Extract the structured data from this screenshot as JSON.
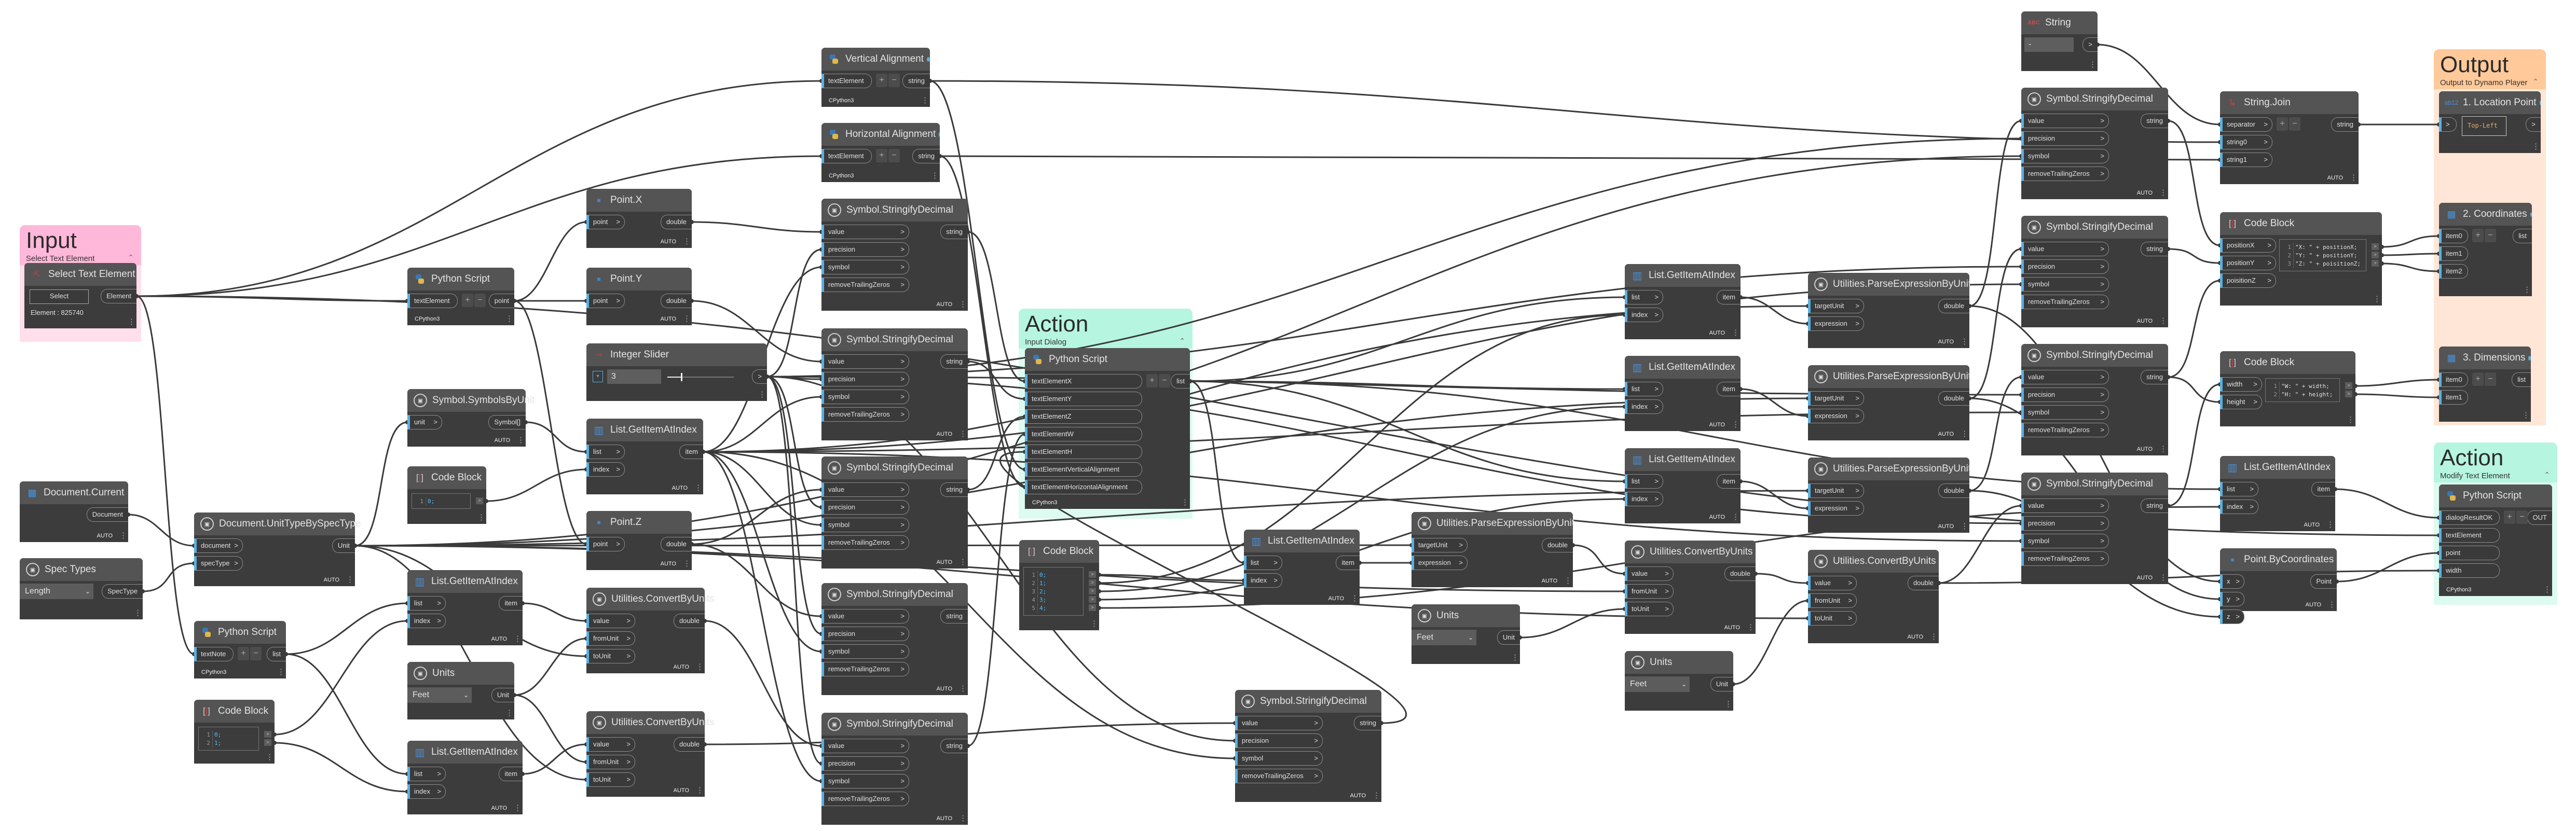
{
  "canvas": {
    "background": "#ffffff",
    "wire_color": "#3a3a3a",
    "port_accent": "#5bb0e0"
  },
  "groups": [
    {
      "title": "Input",
      "subtitle": "Select Text Element",
      "header_color": "#ffb8d9",
      "body_color": "#ffdfeb"
    },
    {
      "title": "Action",
      "subtitle": "Input Dialog",
      "header_color": "#b6f5df",
      "body_color": "#ddfbf0"
    },
    {
      "title": "Output",
      "subtitle": "Output to Dynamo Player",
      "header_color": "#ffc999",
      "body_color": "#ffe6d6"
    },
    {
      "title": "Action",
      "subtitle": "Modify Text Element",
      "header_color": "#b6f5df",
      "body_color": "#ddfbf0"
    }
  ],
  "nodes": [
    {
      "title": "Select Text Element",
      "icon": "select-element-icon",
      "pinned": true,
      "inputs": [],
      "outputs": [
        "Element"
      ],
      "footer": "",
      "widget": {
        "kind": "select",
        "button": "Select",
        "info": "Element : 825740"
      }
    },
    {
      "title": "Document.Current",
      "icon": "document-icon",
      "inputs": [],
      "outputs": [
        "Document"
      ],
      "footer": "AUTO"
    },
    {
      "title": "Spec Types",
      "icon": "revit-node-icon",
      "inputs": [],
      "outputs": [
        "SpecType"
      ],
      "footer": "",
      "widget": {
        "kind": "dropdown",
        "value": "Length"
      }
    },
    {
      "title": "Document.UnitTypeBySpecType",
      "icon": "revit-node-icon",
      "inputs": [
        "document",
        "specType"
      ],
      "outputs": [
        "Unit"
      ],
      "footer": "AUTO"
    },
    {
      "title": "Python Script",
      "icon": "python-icon",
      "plus_minus": true,
      "inputs": [
        "textNote"
      ],
      "outputs": [
        "list"
      ],
      "footer": "CPython3"
    },
    {
      "title": "Code Block",
      "icon": "code-block-icon",
      "inputs": [],
      "outputs": [],
      "footer": "",
      "widget": {
        "kind": "code",
        "lines": [
          {
            "n": "1",
            "code": "0;"
          },
          {
            "n": "2",
            "code": "1;"
          }
        ]
      }
    },
    {
      "title": "Python Script",
      "icon": "python-icon",
      "plus_minus": true,
      "inputs": [
        "textElement"
      ],
      "outputs": [
        "point"
      ],
      "footer": "CPython3"
    },
    {
      "title": "Symbol.SymbolsByUnit",
      "icon": "revit-node-icon",
      "inputs": [
        "unit"
      ],
      "outputs": [
        "Symbol[]"
      ],
      "footer": "AUTO"
    },
    {
      "title": "Code Block",
      "icon": "code-block-icon",
      "inputs": [],
      "outputs": [],
      "footer": "",
      "widget": {
        "kind": "code",
        "lines": [
          {
            "n": "1",
            "code": "0;"
          }
        ]
      }
    },
    {
      "title": "List.GetItemAtIndex",
      "icon": "list-icon",
      "inputs": [
        "list",
        "index"
      ],
      "outputs": [
        "item"
      ],
      "footer": "AUTO"
    },
    {
      "title": "Units",
      "icon": "revit-node-icon",
      "inputs": [],
      "outputs": [
        "Unit"
      ],
      "footer": "",
      "widget": {
        "kind": "dropdown",
        "value": "Feet"
      }
    },
    {
      "title": "List.GetItemAtIndex",
      "icon": "list-icon",
      "inputs": [
        "list",
        "index"
      ],
      "outputs": [
        "item"
      ],
      "footer": "AUTO"
    },
    {
      "title": "Point.X",
      "icon": "point-icon",
      "inputs": [
        "point"
      ],
      "outputs": [
        "double"
      ],
      "footer": "AUTO"
    },
    {
      "title": "Point.Y",
      "icon": "point-icon",
      "inputs": [
        "point"
      ],
      "outputs": [
        "double"
      ],
      "footer": "AUTO"
    },
    {
      "title": "Integer Slider",
      "icon": "slider-icon",
      "inputs": [],
      "outputs": [
        ">"
      ],
      "footer": "",
      "widget": {
        "kind": "slider",
        "value": "3"
      }
    },
    {
      "title": "List.GetItemAtIndex",
      "icon": "list-icon",
      "inputs": [
        "list",
        "index"
      ],
      "outputs": [
        "item"
      ],
      "footer": "AUTO"
    },
    {
      "title": "Point.Z",
      "icon": "point-icon",
      "inputs": [
        "point"
      ],
      "outputs": [
        "double"
      ],
      "footer": "AUTO"
    },
    {
      "title": "Utilities.ConvertByUnits",
      "icon": "revit-node-icon",
      "inputs": [
        "value",
        "fromUnit",
        "toUnit"
      ],
      "outputs": [
        "double"
      ],
      "footer": "AUTO"
    },
    {
      "title": "Utilities.ConvertByUnits",
      "icon": "revit-node-icon",
      "inputs": [
        "value",
        "fromUnit",
        "toUnit"
      ],
      "outputs": [
        "double"
      ],
      "footer": "AUTO"
    },
    {
      "title": "Vertical Alignment",
      "icon": "python-icon",
      "pinned": true,
      "plus_minus": true,
      "inputs": [
        "textElement"
      ],
      "outputs": [
        "string"
      ],
      "footer": "CPython3"
    },
    {
      "title": "Horizontal Alignment",
      "icon": "python-icon",
      "pinned": true,
      "plus_minus": true,
      "inputs": [
        "textElement"
      ],
      "outputs": [
        "string"
      ],
      "footer": "CPython3"
    },
    {
      "title": "Symbol.StringifyDecimal",
      "icon": "revit-node-icon",
      "inputs": [
        "value",
        "precision",
        "symbol",
        "removeTrailingZeros"
      ],
      "outputs": [
        "string"
      ],
      "footer": "AUTO"
    },
    {
      "title": "Symbol.StringifyDecimal",
      "icon": "revit-node-icon",
      "inputs": [
        "value",
        "precision",
        "symbol",
        "removeTrailingZeros"
      ],
      "outputs": [
        "string"
      ],
      "footer": "AUTO"
    },
    {
      "title": "Symbol.StringifyDecimal",
      "icon": "revit-node-icon",
      "inputs": [
        "value",
        "precision",
        "symbol",
        "removeTrailingZeros"
      ],
      "outputs": [
        "string"
      ],
      "footer": "AUTO"
    },
    {
      "title": "Symbol.StringifyDecimal",
      "icon": "revit-node-icon",
      "inputs": [
        "value",
        "precision",
        "symbol",
        "removeTrailingZeros"
      ],
      "outputs": [
        "string"
      ],
      "footer": "AUTO"
    },
    {
      "title": "Symbol.StringifyDecimal",
      "icon": "revit-node-icon",
      "inputs": [
        "value",
        "precision",
        "symbol",
        "removeTrailingZeros"
      ],
      "outputs": [
        "string"
      ],
      "footer": "AUTO"
    },
    {
      "title": "Symbol.StringifyDecimal",
      "icon": "revit-node-icon",
      "inputs": [
        "value",
        "precision",
        "symbol",
        "removeTrailingZeros"
      ],
      "outputs": [
        "string"
      ],
      "footer": "AUTO"
    },
    {
      "title": "Python Script",
      "icon": "python-icon",
      "plus_minus": true,
      "inputs": [
        "textElementX",
        "textElementY",
        "textElementZ",
        "textElementW",
        "textElementH",
        "textElementVerticalAlignment",
        "textElementHorizontalAlignment"
      ],
      "outputs": [
        "list"
      ],
      "footer": "CPython3"
    },
    {
      "title": "Code Block",
      "icon": "code-block-icon",
      "inputs": [],
      "outputs": [],
      "footer": "",
      "widget": {
        "kind": "code",
        "lines": [
          {
            "n": "1",
            "code": "0;"
          },
          {
            "n": "2",
            "code": "1;"
          },
          {
            "n": "3",
            "code": "2;"
          },
          {
            "n": "4",
            "code": "3;"
          },
          {
            "n": "5",
            "code": "4;"
          }
        ]
      }
    },
    {
      "title": "List.GetItemAtIndex",
      "icon": "list-icon",
      "inputs": [
        "list",
        "index"
      ],
      "outputs": [
        "item"
      ],
      "footer": "AUTO"
    },
    {
      "title": "Utilities.ParseExpressionByUnit",
      "icon": "revit-node-icon",
      "inputs": [
        "targetUnit",
        "expression"
      ],
      "outputs": [
        "double"
      ],
      "footer": "AUTO"
    },
    {
      "title": "Units",
      "icon": "revit-node-icon",
      "inputs": [],
      "outputs": [
        "Unit"
      ],
      "footer": "",
      "widget": {
        "kind": "dropdown",
        "value": "Feet"
      }
    },
    {
      "title": "Utilities.ConvertByUnits",
      "icon": "revit-node-icon",
      "inputs": [
        "value",
        "fromUnit",
        "toUnit"
      ],
      "outputs": [
        "double"
      ],
      "footer": "AUTO"
    },
    {
      "title": "Units",
      "icon": "revit-node-icon",
      "inputs": [],
      "outputs": [
        "Unit"
      ],
      "footer": "",
      "widget": {
        "kind": "dropdown",
        "value": "Feet"
      }
    },
    {
      "title": "Utilities.ConvertByUnits",
      "icon": "revit-node-icon",
      "inputs": [
        "value",
        "fromUnit",
        "toUnit"
      ],
      "outputs": [
        "double"
      ],
      "footer": "AUTO"
    },
    {
      "title": "List.GetItemAtIndex",
      "icon": "list-icon",
      "inputs": [
        "list",
        "index"
      ],
      "outputs": [
        "item"
      ],
      "footer": "AUTO"
    },
    {
      "title": "List.GetItemAtIndex",
      "icon": "list-icon",
      "inputs": [
        "list",
        "index"
      ],
      "outputs": [
        "item"
      ],
      "footer": "AUTO"
    },
    {
      "title": "List.GetItemAtIndex",
      "icon": "list-icon",
      "inputs": [
        "list",
        "index"
      ],
      "outputs": [
        "item"
      ],
      "footer": "AUTO"
    },
    {
      "title": "Utilities.ParseExpressionByUnit",
      "icon": "revit-node-icon",
      "inputs": [
        "targetUnit",
        "expression"
      ],
      "outputs": [
        "double"
      ],
      "footer": "AUTO"
    },
    {
      "title": "Utilities.ParseExpressionByUnit",
      "icon": "revit-node-icon",
      "inputs": [
        "targetUnit",
        "expression"
      ],
      "outputs": [
        "double"
      ],
      "footer": "AUTO"
    },
    {
      "title": "Utilities.ParseExpressionByUnit",
      "icon": "revit-node-icon",
      "inputs": [
        "targetUnit",
        "expression"
      ],
      "outputs": [
        "double"
      ],
      "footer": "AUTO"
    },
    {
      "title": "String",
      "icon": "string-icon",
      "inputs": [],
      "outputs": [
        ">"
      ],
      "footer": "",
      "widget": {
        "kind": "string",
        "value": "-"
      }
    },
    {
      "title": "Symbol.StringifyDecimal",
      "icon": "revit-node-icon",
      "inputs": [
        "value",
        "precision",
        "symbol",
        "removeTrailingZeros"
      ],
      "outputs": [
        "string"
      ],
      "footer": "AUTO"
    },
    {
      "title": "Symbol.StringifyDecimal",
      "icon": "revit-node-icon",
      "inputs": [
        "value",
        "precision",
        "symbol",
        "removeTrailingZeros"
      ],
      "outputs": [
        "string"
      ],
      "footer": "AUTO"
    },
    {
      "title": "Symbol.StringifyDecimal",
      "icon": "revit-node-icon",
      "inputs": [
        "value",
        "precision",
        "symbol",
        "removeTrailingZeros"
      ],
      "outputs": [
        "string"
      ],
      "footer": "AUTO"
    },
    {
      "title": "Symbol.StringifyDecimal",
      "icon": "revit-node-icon",
      "inputs": [
        "value",
        "precision",
        "symbol",
        "removeTrailingZeros"
      ],
      "outputs": [
        "string"
      ],
      "footer": "AUTO"
    },
    {
      "title": "String.Join",
      "icon": "string-join-icon",
      "plus_minus": true,
      "inputs": [
        "separator",
        "string0",
        "string1"
      ],
      "outputs": [
        "string"
      ],
      "footer": "AUTO"
    },
    {
      "title": "Code Block",
      "icon": "code-block-icon",
      "inputs": [
        "positionX",
        "positionY",
        "poisitionZ"
      ],
      "outputs": [],
      "footer": "",
      "widget": {
        "kind": "code",
        "lines": [
          {
            "n": "1",
            "code": "\"X: \" + positionX;"
          },
          {
            "n": "2",
            "code": "\"Y: \" + positionY;"
          },
          {
            "n": "3",
            "code": "\"Z: \" + poisitionZ;"
          }
        ]
      }
    },
    {
      "title": "Code Block",
      "icon": "code-block-icon",
      "inputs": [
        "width",
        "height"
      ],
      "outputs": [],
      "footer": "",
      "widget": {
        "kind": "code",
        "lines": [
          {
            "n": "1",
            "code": "\"W: \" + width;"
          },
          {
            "n": "2",
            "code": "\"H: \" + height;"
          }
        ]
      }
    },
    {
      "title": "List.GetItemAtIndex",
      "icon": "list-icon",
      "inputs": [
        "list",
        "index"
      ],
      "outputs": [
        "item"
      ],
      "footer": "AUTO"
    },
    {
      "title": "Point.ByCoordinates",
      "icon": "point-icon",
      "inputs": [
        "x",
        "y",
        "z"
      ],
      "outputs": [
        "Point"
      ],
      "footer": "AUTO"
    },
    {
      "title": "1. Location Point",
      "icon": "watch-icon",
      "pinned": true,
      "inputs": [
        ">"
      ],
      "outputs": [
        ">"
      ],
      "footer": "",
      "widget": {
        "kind": "watch",
        "value": "Top-Left"
      }
    },
    {
      "title": "2. Coordinates",
      "icon": "list-create-icon",
      "pinned": true,
      "plus_minus": true,
      "inputs": [
        "item0",
        "item1",
        "item2"
      ],
      "outputs": [
        "list"
      ],
      "footer": ""
    },
    {
      "title": "3. Dimensions",
      "icon": "list-create-icon",
      "pinned": true,
      "plus_minus": true,
      "inputs": [
        "item0",
        "item1"
      ],
      "outputs": [
        "list"
      ],
      "footer": ""
    },
    {
      "title": "Python Script",
      "icon": "python-icon",
      "plus_minus": true,
      "inputs": [
        "dialogResultOK",
        "textElement",
        "point",
        "width"
      ],
      "outputs": [
        "OUT"
      ],
      "footer": "CPython3"
    }
  ]
}
